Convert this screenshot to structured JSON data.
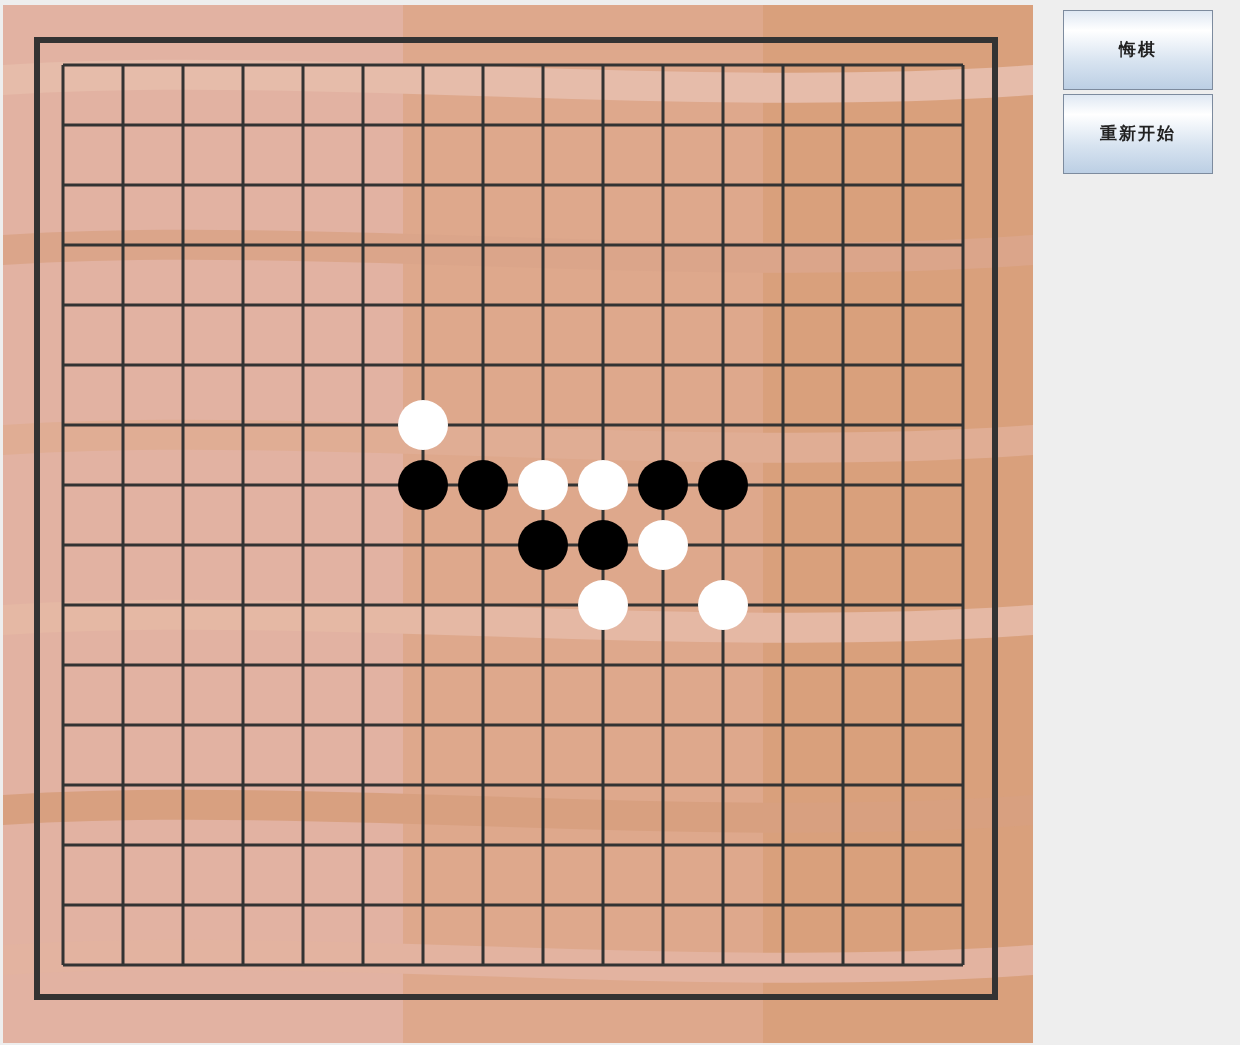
{
  "board": {
    "kind": "picture",
    "rows": [
      {
        "points": [
          {
            "kind": "empty"
          },
          {
            "kind": "empty"
          },
          {
            "kind": "empty"
          },
          {
            "kind": "empty"
          },
          {
            "kind": "empty"
          },
          {
            "kind": "empty"
          },
          {
            "kind": "empty"
          },
          {
            "kind": "empty"
          },
          {
            "kind": "empty"
          },
          {
            "kind": "empty"
          },
          {
            "kind": "empty"
          },
          {
            "kind": "empty"
          },
          {
            "kind": "empty"
          },
          {
            "kind": "empty"
          },
          {
            "kind": "empty"
          },
          {
            "kind": "empty"
          }
        ]
      },
      {
        "points": [
          {
            "kind": "empty"
          },
          {
            "kind": "empty"
          },
          {
            "kind": "empty"
          },
          {
            "kind": "empty"
          },
          {
            "kind": "empty"
          },
          {
            "kind": "empty"
          },
          {
            "kind": "empty"
          },
          {
            "kind": "empty"
          },
          {
            "kind": "empty"
          },
          {
            "kind": "empty"
          },
          {
            "kind": "empty"
          },
          {
            "kind": "empty"
          },
          {
            "kind": "empty"
          },
          {
            "kind": "empty"
          },
          {
            "kind": "empty"
          },
          {
            "kind": "empty"
          }
        ]
      },
      {
        "points": [
          {
            "kind": "empty"
          },
          {
            "kind": "empty"
          },
          {
            "kind": "empty"
          },
          {
            "kind": "empty"
          },
          {
            "kind": "empty"
          },
          {
            "kind": "empty"
          },
          {
            "kind": "empty"
          },
          {
            "kind": "empty"
          },
          {
            "kind": "empty"
          },
          {
            "kind": "empty"
          },
          {
            "kind": "empty"
          },
          {
            "kind": "empty"
          },
          {
            "kind": "empty"
          },
          {
            "kind": "empty"
          },
          {
            "kind": "empty"
          },
          {
            "kind": "empty"
          }
        ]
      },
      {
        "points": [
          {
            "kind": "empty"
          },
          {
            "kind": "empty"
          },
          {
            "kind": "empty"
          },
          {
            "kind": "empty"
          },
          {
            "kind": "empty"
          },
          {
            "kind": "empty"
          },
          {
            "kind": "empty"
          },
          {
            "kind": "empty"
          },
          {
            "kind": "empty"
          },
          {
            "kind": "empty"
          },
          {
            "kind": "empty"
          },
          {
            "kind": "empty"
          },
          {
            "kind": "empty"
          },
          {
            "kind": "empty"
          },
          {
            "kind": "empty"
          },
          {
            "kind": "empty"
          }
        ]
      },
      {
        "points": [
          {
            "kind": "empty"
          },
          {
            "kind": "empty"
          },
          {
            "kind": "empty"
          },
          {
            "kind": "empty"
          },
          {
            "kind": "empty"
          },
          {
            "kind": "empty"
          },
          {
            "kind": "empty"
          },
          {
            "kind": "empty"
          },
          {
            "kind": "empty"
          },
          {
            "kind": "empty"
          },
          {
            "kind": "empty"
          },
          {
            "kind": "empty"
          },
          {
            "kind": "empty"
          },
          {
            "kind": "empty"
          },
          {
            "kind": "empty"
          },
          {
            "kind": "empty"
          }
        ]
      },
      {
        "points": [
          {
            "kind": "empty"
          },
          {
            "kind": "empty"
          },
          {
            "kind": "empty"
          },
          {
            "kind": "empty"
          },
          {
            "kind": "empty"
          },
          {
            "kind": "empty"
          },
          {
            "kind": "empty"
          },
          {
            "kind": "empty"
          },
          {
            "kind": "empty"
          },
          {
            "kind": "empty"
          },
          {
            "kind": "empty"
          },
          {
            "kind": "empty"
          },
          {
            "kind": "empty"
          },
          {
            "kind": "empty"
          },
          {
            "kind": "empty"
          },
          {
            "kind": "empty"
          }
        ]
      },
      {
        "points": [
          {
            "kind": "empty"
          },
          {
            "kind": "empty"
          },
          {
            "kind": "empty"
          },
          {
            "kind": "empty"
          },
          {
            "kind": "empty"
          },
          {
            "kind": "empty"
          },
          {
            "kind": "white"
          },
          {
            "kind": "empty"
          },
          {
            "kind": "empty"
          },
          {
            "kind": "empty"
          },
          {
            "kind": "empty"
          },
          {
            "kind": "empty"
          },
          {
            "kind": "empty"
          },
          {
            "kind": "empty"
          },
          {
            "kind": "empty"
          },
          {
            "kind": "empty"
          }
        ]
      },
      {
        "points": [
          {
            "kind": "empty"
          },
          {
            "kind": "empty"
          },
          {
            "kind": "empty"
          },
          {
            "kind": "empty"
          },
          {
            "kind": "empty"
          },
          {
            "kind": "empty"
          },
          {
            "kind": "black"
          },
          {
            "kind": "black"
          },
          {
            "kind": "white"
          },
          {
            "kind": "white"
          },
          {
            "kind": "black"
          },
          {
            "kind": "black"
          },
          {
            "kind": "empty"
          },
          {
            "kind": "empty"
          },
          {
            "kind": "empty"
          },
          {
            "kind": "empty"
          }
        ]
      },
      {
        "points": [
          {
            "kind": "empty"
          },
          {
            "kind": "empty"
          },
          {
            "kind": "empty"
          },
          {
            "kind": "empty"
          },
          {
            "kind": "empty"
          },
          {
            "kind": "empty"
          },
          {
            "kind": "empty"
          },
          {
            "kind": "empty"
          },
          {
            "kind": "black"
          },
          {
            "kind": "black"
          },
          {
            "kind": "white"
          },
          {
            "kind": "empty"
          },
          {
            "kind": "empty"
          },
          {
            "kind": "empty"
          },
          {
            "kind": "empty"
          },
          {
            "kind": "empty"
          }
        ]
      },
      {
        "points": [
          {
            "kind": "empty"
          },
          {
            "kind": "empty"
          },
          {
            "kind": "empty"
          },
          {
            "kind": "empty"
          },
          {
            "kind": "empty"
          },
          {
            "kind": "empty"
          },
          {
            "kind": "empty"
          },
          {
            "kind": "empty"
          },
          {
            "kind": "empty"
          },
          {
            "kind": "white"
          },
          {
            "kind": "empty"
          },
          {
            "kind": "white"
          },
          {
            "kind": "empty"
          },
          {
            "kind": "empty"
          },
          {
            "kind": "empty"
          },
          {
            "kind": "empty"
          }
        ]
      },
      {
        "points": [
          {
            "kind": "empty"
          },
          {
            "kind": "empty"
          },
          {
            "kind": "empty"
          },
          {
            "kind": "empty"
          },
          {
            "kind": "empty"
          },
          {
            "kind": "empty"
          },
          {
            "kind": "empty"
          },
          {
            "kind": "empty"
          },
          {
            "kind": "empty"
          },
          {
            "kind": "empty"
          },
          {
            "kind": "empty"
          },
          {
            "kind": "empty"
          },
          {
            "kind": "empty"
          },
          {
            "kind": "empty"
          },
          {
            "kind": "empty"
          },
          {
            "kind": "empty"
          }
        ]
      },
      {
        "points": [
          {
            "kind": "empty"
          },
          {
            "kind": "empty"
          },
          {
            "kind": "empty"
          },
          {
            "kind": "empty"
          },
          {
            "kind": "empty"
          },
          {
            "kind": "empty"
          },
          {
            "kind": "empty"
          },
          {
            "kind": "empty"
          },
          {
            "kind": "empty"
          },
          {
            "kind": "empty"
          },
          {
            "kind": "empty"
          },
          {
            "kind": "empty"
          },
          {
            "kind": "empty"
          },
          {
            "kind": "empty"
          },
          {
            "kind": "empty"
          },
          {
            "kind": "empty"
          }
        ]
      },
      {
        "points": [
          {
            "kind": "empty"
          },
          {
            "kind": "empty"
          },
          {
            "kind": "empty"
          },
          {
            "kind": "empty"
          },
          {
            "kind": "empty"
          },
          {
            "kind": "empty"
          },
          {
            "kind": "empty"
          },
          {
            "kind": "empty"
          },
          {
            "kind": "empty"
          },
          {
            "kind": "empty"
          },
          {
            "kind": "empty"
          },
          {
            "kind": "empty"
          },
          {
            "kind": "empty"
          },
          {
            "kind": "empty"
          },
          {
            "kind": "empty"
          },
          {
            "kind": "empty"
          }
        ]
      },
      {
        "points": [
          {
            "kind": "empty"
          },
          {
            "kind": "empty"
          },
          {
            "kind": "empty"
          },
          {
            "kind": "empty"
          },
          {
            "kind": "empty"
          },
          {
            "kind": "empty"
          },
          {
            "kind": "empty"
          },
          {
            "kind": "empty"
          },
          {
            "kind": "empty"
          },
          {
            "kind": "empty"
          },
          {
            "kind": "empty"
          },
          {
            "kind": "empty"
          },
          {
            "kind": "empty"
          },
          {
            "kind": "empty"
          },
          {
            "kind": "empty"
          },
          {
            "kind": "empty"
          }
        ]
      },
      {
        "points": [
          {
            "kind": "empty"
          },
          {
            "kind": "empty"
          },
          {
            "kind": "empty"
          },
          {
            "kind": "empty"
          },
          {
            "kind": "empty"
          },
          {
            "kind": "empty"
          },
          {
            "kind": "empty"
          },
          {
            "kind": "empty"
          },
          {
            "kind": "empty"
          },
          {
            "kind": "empty"
          },
          {
            "kind": "empty"
          },
          {
            "kind": "empty"
          },
          {
            "kind": "empty"
          },
          {
            "kind": "empty"
          },
          {
            "kind": "empty"
          },
          {
            "kind": "empty"
          }
        ]
      },
      {
        "points": [
          {
            "kind": "empty"
          },
          {
            "kind": "empty"
          },
          {
            "kind": "empty"
          },
          {
            "kind": "empty"
          },
          {
            "kind": "empty"
          },
          {
            "kind": "empty"
          },
          {
            "kind": "empty"
          },
          {
            "kind": "empty"
          },
          {
            "kind": "empty"
          },
          {
            "kind": "empty"
          },
          {
            "kind": "empty"
          },
          {
            "kind": "empty"
          },
          {
            "kind": "empty"
          },
          {
            "kind": "empty"
          },
          {
            "kind": "empty"
          },
          {
            "kind": "empty"
          }
        ]
      }
    ]
  },
  "buttons": [
    "悔棋",
    "重新开始"
  ]
}
